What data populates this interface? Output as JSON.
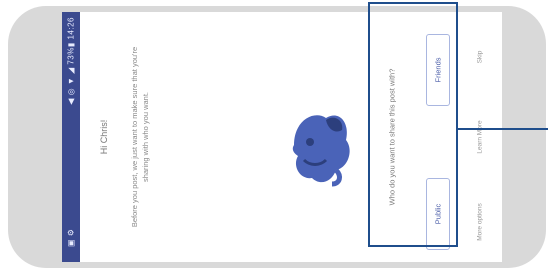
{
  "status_bar": {
    "left": "▣ ⚙",
    "right": "◀ ◎ ▼ ◢ 73%▮ 14:26"
  },
  "welcome": {
    "title": "Hi Chris!",
    "text": "Before you post, we just want to make sure that you're sharing with who you want."
  },
  "share_prompt": {
    "question": "Who do you want to share this post with?",
    "options": [
      "Public",
      "Friends"
    ]
  },
  "bottom_nav": [
    "More options",
    "Learn More",
    "Skip"
  ],
  "colors": {
    "accent": "#3b4a8f",
    "highlight": "#1f4e8c"
  }
}
